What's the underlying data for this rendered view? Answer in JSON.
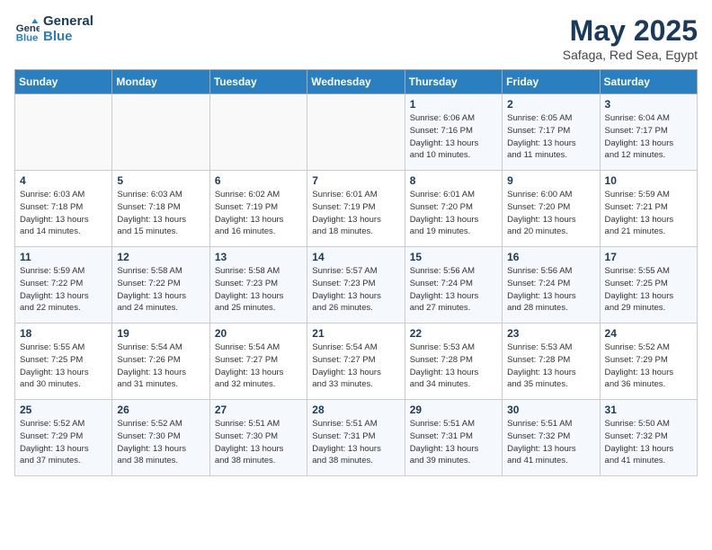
{
  "header": {
    "logo_line1": "General",
    "logo_line2": "Blue",
    "month": "May 2025",
    "location": "Safaga, Red Sea, Egypt"
  },
  "weekdays": [
    "Sunday",
    "Monday",
    "Tuesday",
    "Wednesday",
    "Thursday",
    "Friday",
    "Saturday"
  ],
  "weeks": [
    [
      {
        "day": "",
        "info": ""
      },
      {
        "day": "",
        "info": ""
      },
      {
        "day": "",
        "info": ""
      },
      {
        "day": "",
        "info": ""
      },
      {
        "day": "1",
        "info": "Sunrise: 6:06 AM\nSunset: 7:16 PM\nDaylight: 13 hours\nand 10 minutes."
      },
      {
        "day": "2",
        "info": "Sunrise: 6:05 AM\nSunset: 7:17 PM\nDaylight: 13 hours\nand 11 minutes."
      },
      {
        "day": "3",
        "info": "Sunrise: 6:04 AM\nSunset: 7:17 PM\nDaylight: 13 hours\nand 12 minutes."
      }
    ],
    [
      {
        "day": "4",
        "info": "Sunrise: 6:03 AM\nSunset: 7:18 PM\nDaylight: 13 hours\nand 14 minutes."
      },
      {
        "day": "5",
        "info": "Sunrise: 6:03 AM\nSunset: 7:18 PM\nDaylight: 13 hours\nand 15 minutes."
      },
      {
        "day": "6",
        "info": "Sunrise: 6:02 AM\nSunset: 7:19 PM\nDaylight: 13 hours\nand 16 minutes."
      },
      {
        "day": "7",
        "info": "Sunrise: 6:01 AM\nSunset: 7:19 PM\nDaylight: 13 hours\nand 18 minutes."
      },
      {
        "day": "8",
        "info": "Sunrise: 6:01 AM\nSunset: 7:20 PM\nDaylight: 13 hours\nand 19 minutes."
      },
      {
        "day": "9",
        "info": "Sunrise: 6:00 AM\nSunset: 7:20 PM\nDaylight: 13 hours\nand 20 minutes."
      },
      {
        "day": "10",
        "info": "Sunrise: 5:59 AM\nSunset: 7:21 PM\nDaylight: 13 hours\nand 21 minutes."
      }
    ],
    [
      {
        "day": "11",
        "info": "Sunrise: 5:59 AM\nSunset: 7:22 PM\nDaylight: 13 hours\nand 22 minutes."
      },
      {
        "day": "12",
        "info": "Sunrise: 5:58 AM\nSunset: 7:22 PM\nDaylight: 13 hours\nand 24 minutes."
      },
      {
        "day": "13",
        "info": "Sunrise: 5:58 AM\nSunset: 7:23 PM\nDaylight: 13 hours\nand 25 minutes."
      },
      {
        "day": "14",
        "info": "Sunrise: 5:57 AM\nSunset: 7:23 PM\nDaylight: 13 hours\nand 26 minutes."
      },
      {
        "day": "15",
        "info": "Sunrise: 5:56 AM\nSunset: 7:24 PM\nDaylight: 13 hours\nand 27 minutes."
      },
      {
        "day": "16",
        "info": "Sunrise: 5:56 AM\nSunset: 7:24 PM\nDaylight: 13 hours\nand 28 minutes."
      },
      {
        "day": "17",
        "info": "Sunrise: 5:55 AM\nSunset: 7:25 PM\nDaylight: 13 hours\nand 29 minutes."
      }
    ],
    [
      {
        "day": "18",
        "info": "Sunrise: 5:55 AM\nSunset: 7:25 PM\nDaylight: 13 hours\nand 30 minutes."
      },
      {
        "day": "19",
        "info": "Sunrise: 5:54 AM\nSunset: 7:26 PM\nDaylight: 13 hours\nand 31 minutes."
      },
      {
        "day": "20",
        "info": "Sunrise: 5:54 AM\nSunset: 7:27 PM\nDaylight: 13 hours\nand 32 minutes."
      },
      {
        "day": "21",
        "info": "Sunrise: 5:54 AM\nSunset: 7:27 PM\nDaylight: 13 hours\nand 33 minutes."
      },
      {
        "day": "22",
        "info": "Sunrise: 5:53 AM\nSunset: 7:28 PM\nDaylight: 13 hours\nand 34 minutes."
      },
      {
        "day": "23",
        "info": "Sunrise: 5:53 AM\nSunset: 7:28 PM\nDaylight: 13 hours\nand 35 minutes."
      },
      {
        "day": "24",
        "info": "Sunrise: 5:52 AM\nSunset: 7:29 PM\nDaylight: 13 hours\nand 36 minutes."
      }
    ],
    [
      {
        "day": "25",
        "info": "Sunrise: 5:52 AM\nSunset: 7:29 PM\nDaylight: 13 hours\nand 37 minutes."
      },
      {
        "day": "26",
        "info": "Sunrise: 5:52 AM\nSunset: 7:30 PM\nDaylight: 13 hours\nand 38 minutes."
      },
      {
        "day": "27",
        "info": "Sunrise: 5:51 AM\nSunset: 7:30 PM\nDaylight: 13 hours\nand 38 minutes."
      },
      {
        "day": "28",
        "info": "Sunrise: 5:51 AM\nSunset: 7:31 PM\nDaylight: 13 hours\nand 38 minutes."
      },
      {
        "day": "29",
        "info": "Sunrise: 5:51 AM\nSunset: 7:31 PM\nDaylight: 13 hours\nand 39 minutes."
      },
      {
        "day": "30",
        "info": "Sunrise: 5:51 AM\nSunset: 7:32 PM\nDaylight: 13 hours\nand 41 minutes."
      },
      {
        "day": "31",
        "info": "Sunrise: 5:50 AM\nSunset: 7:32 PM\nDaylight: 13 hours\nand 41 minutes."
      }
    ]
  ]
}
